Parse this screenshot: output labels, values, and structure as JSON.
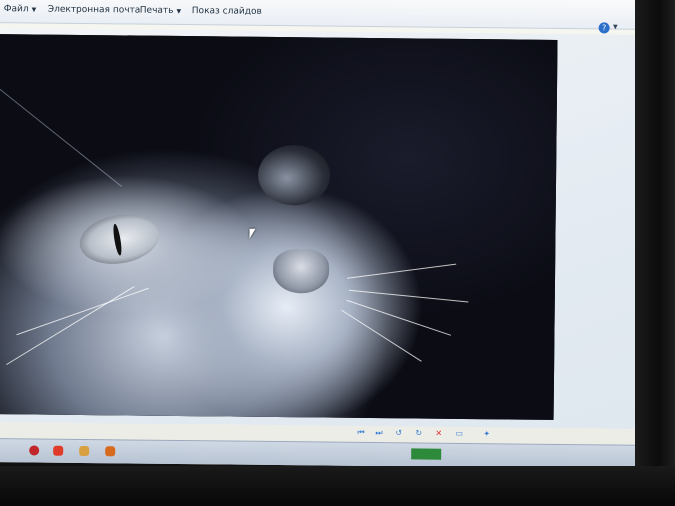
{
  "menubar": {
    "items": [
      {
        "label": "Файл",
        "has_dropdown": true
      },
      {
        "label": "Электронная почта",
        "has_dropdown": false
      },
      {
        "label": "Печать",
        "has_dropdown": true
      },
      {
        "label": "Показ слайдов",
        "has_dropdown": false
      }
    ],
    "help_icon": "help-icon",
    "help_label": "?"
  },
  "viewer": {
    "image_subject": "cat close-up",
    "cursor_icon": "mouse-pointer-icon"
  },
  "toolbar": {
    "buttons": [
      {
        "icon": "previous-icon",
        "glyph": "⏮"
      },
      {
        "icon": "play-slideshow-icon",
        "glyph": "⏭"
      },
      {
        "icon": "rotate-left-icon",
        "glyph": "↺"
      },
      {
        "icon": "rotate-right-icon",
        "glyph": "↻"
      },
      {
        "icon": "delete-icon",
        "glyph": "✕"
      },
      {
        "icon": "monitor-icon",
        "glyph": "▭"
      },
      {
        "icon": "zoom-icon",
        "glyph": "✦"
      }
    ]
  },
  "taskbar": {
    "clock_text": "",
    "icons": [
      "opera-icon",
      "yandex-icon",
      "folder-icon",
      "app-icon"
    ]
  },
  "colors": {
    "accent": "#2a6fc9",
    "delete": "#d33333",
    "taskbar_green": "#2d8a3a"
  }
}
